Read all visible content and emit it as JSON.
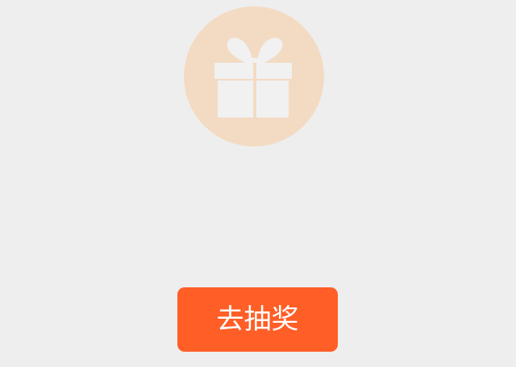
{
  "gift": {
    "icon": "gift-icon",
    "circle_color": "#f3dbc3",
    "icon_color": "#f1f1f1"
  },
  "actions": {
    "lottery_label": "去抽奖",
    "button_color": "#ff5e26"
  }
}
